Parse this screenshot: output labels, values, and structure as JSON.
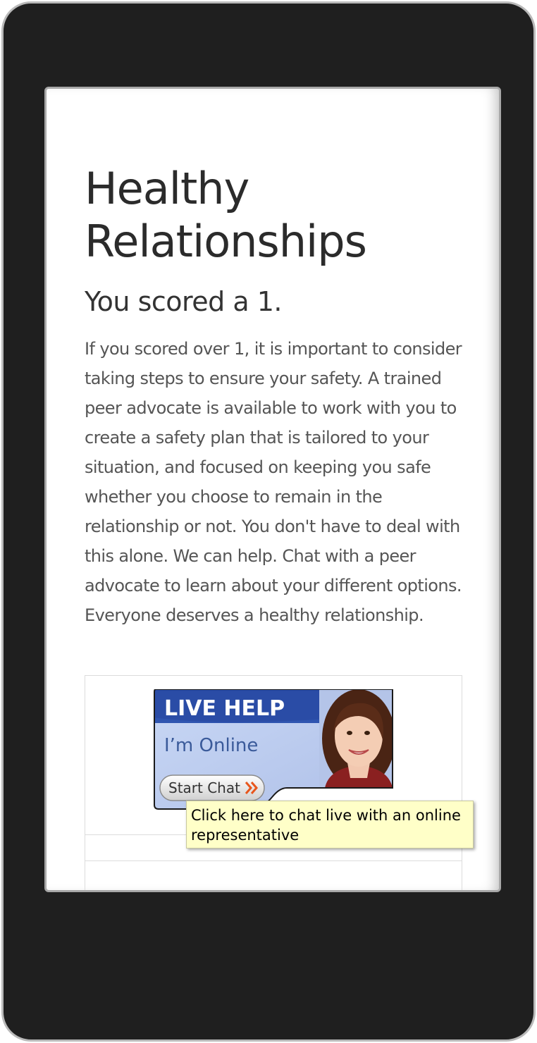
{
  "page": {
    "title": "Healthy Relationships",
    "score": "You scored a 1.",
    "body": "If you scored over 1, it is important to consider taking steps to ensure your safety. A trained peer advocate is available to work with you to create a safety plan that is tailored to your situation, and focused on keeping you safe whether you choose to remain in the relationship or not. You don't have to deal with this alone. We can help. Chat with a peer advocate to learn about your different options. Everyone deserves a healthy relationship."
  },
  "live_help": {
    "heading": "LIVE HELP",
    "status": "I’m Online",
    "button_label": "Start Chat",
    "button_icon": "double-chevron-right-icon"
  },
  "tooltip": {
    "text": "Click here to chat live with an online representative"
  },
  "colors": {
    "banner_blue": "#2a4fa8",
    "banner_light": "#c8d8f4",
    "tooltip_bg": "#ffffc8",
    "chevron_orange": "#e8561c"
  }
}
